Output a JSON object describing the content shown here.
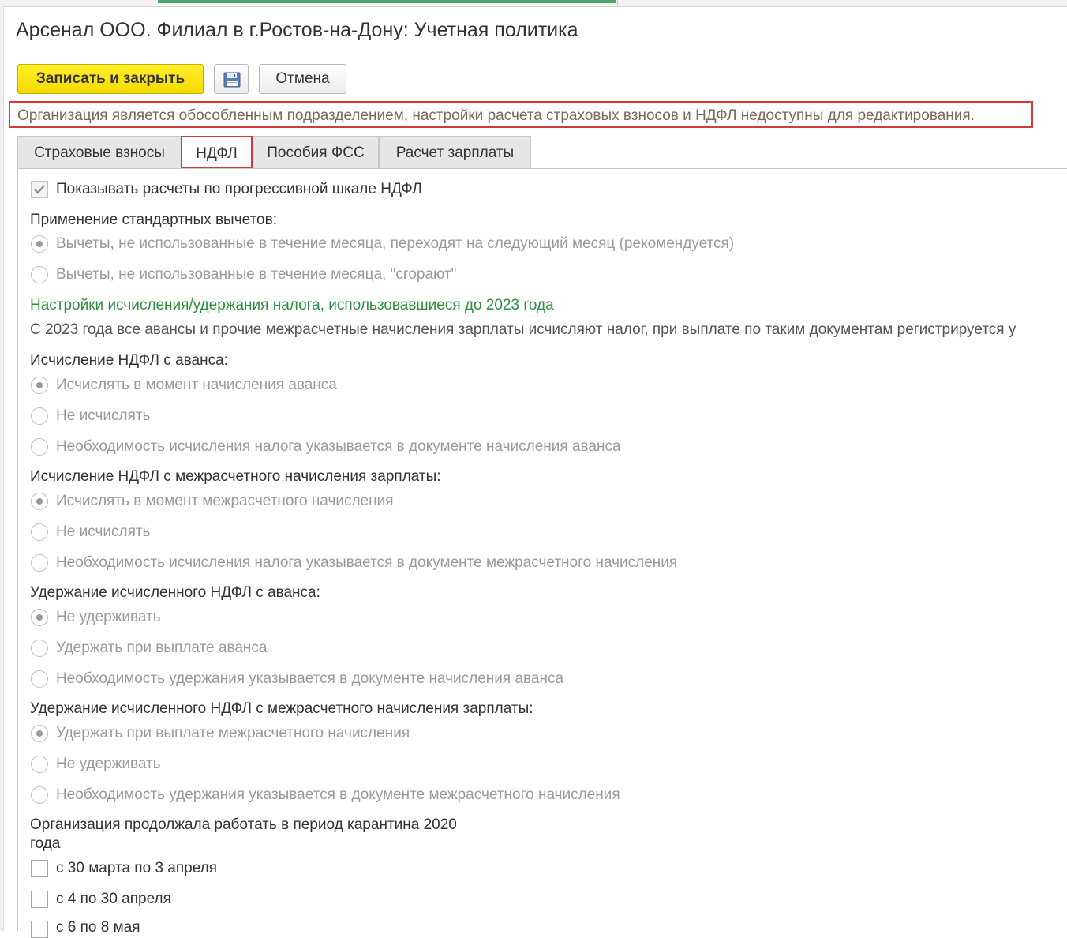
{
  "window": {
    "title": "Арсенал ООО. Филиал в г.Ростов-на-Дону: Учетная политика"
  },
  "toolbar": {
    "save_close_label": "Записать и закрыть",
    "save_icon": "floppy-disk-icon",
    "cancel_label": "Отмена"
  },
  "notice": "Организация является обособленным подразделением, настройки расчета страховых взносов и НДФЛ недоступны для редактирования.",
  "tabs": [
    {
      "label": "Страховые взносы",
      "active": false
    },
    {
      "label": "НДФЛ",
      "active": true
    },
    {
      "label": "Пособия ФСС",
      "active": false
    },
    {
      "label": "Расчет зарплаты",
      "active": false
    }
  ],
  "ndfl": {
    "progressive_checkbox": {
      "label": "Показывать расчеты по прогрессивной шкале НДФЛ",
      "checked": true
    },
    "std_deductions": {
      "label": "Применение стандартных вычетов:",
      "options": [
        {
          "label": "Вычеты, не использованные в течение месяца, переходят на следующий месяц (рекомендуется)",
          "selected": true
        },
        {
          "label": "Вычеты, не использованные в течение месяца, \"сгорают\"",
          "selected": false
        }
      ]
    },
    "legacy_header": "Настройки исчисления/удержания налога, использовавшиеся до 2023 года",
    "legacy_info": "С 2023 года все авансы и прочие межрасчетные начисления зарплаты исчисляют налог, при выплате по таким документам регистрируется у",
    "advance_calc": {
      "label": "Исчисление НДФЛ с аванса:",
      "options": [
        {
          "label": "Исчислять в момент начисления аванса",
          "selected": true
        },
        {
          "label": "Не исчислять",
          "selected": false
        },
        {
          "label": "Необходимость исчисления налога указывается в документе начисления аванса",
          "selected": false
        }
      ]
    },
    "interim_calc": {
      "label": "Исчисление НДФЛ с межрасчетного начисления зарплаты:",
      "options": [
        {
          "label": "Исчислять в момент межрасчетного начисления",
          "selected": true
        },
        {
          "label": "Не исчислять",
          "selected": false
        },
        {
          "label": "Необходимость исчисления налога указывается в документе межрасчетного начисления",
          "selected": false
        }
      ]
    },
    "advance_withhold": {
      "label": "Удержание исчисленного НДФЛ с аванса:",
      "options": [
        {
          "label": "Не удерживать",
          "selected": true
        },
        {
          "label": "Удержать при выплате аванса",
          "selected": false
        },
        {
          "label": "Необходимость удержания указывается в документе начисления аванса",
          "selected": false
        }
      ]
    },
    "interim_withhold": {
      "label": "Удержание исчисленного НДФЛ с межрасчетного начисления зарплаты:",
      "options": [
        {
          "label": "Удержать при выплате межрасчетного начисления",
          "selected": true
        },
        {
          "label": "Не удерживать",
          "selected": false
        },
        {
          "label": "Необходимость удержания указывается в документе межрасчетного начисления",
          "selected": false
        }
      ]
    },
    "quarantine": {
      "label_line1": "Организация продолжала работать в период карантина 2020",
      "label_line2": "года",
      "periods": [
        {
          "label": "с 30 марта по 3 апреля",
          "checked": false
        },
        {
          "label": "с 4 по 30 апреля",
          "checked": false
        },
        {
          "label": "с 6 по 8 мая",
          "checked": false
        }
      ]
    }
  }
}
